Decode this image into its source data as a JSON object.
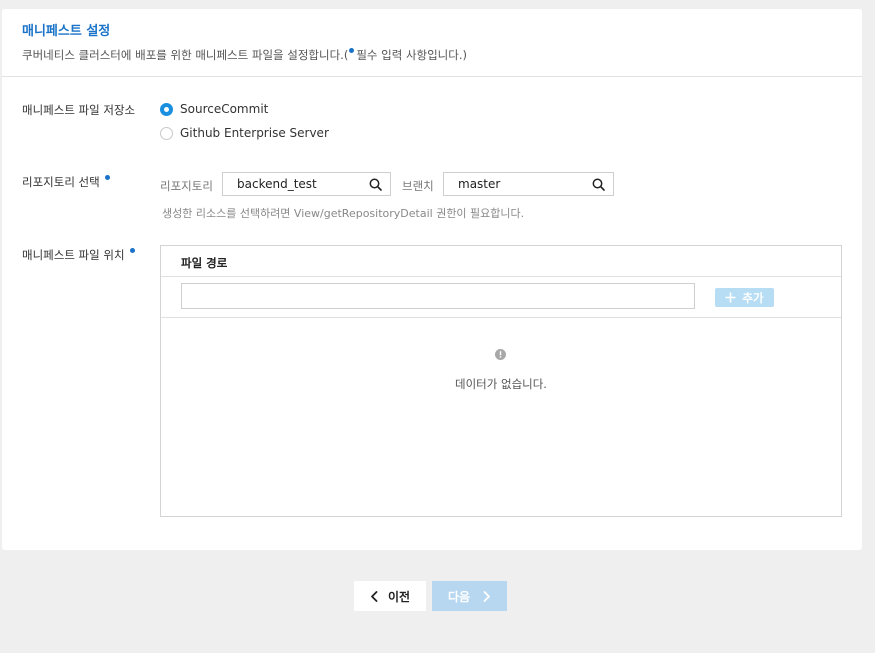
{
  "header": {
    "title": "매니페스트 설정",
    "description": "쿠버네티스 클러스터에 배포를 위한 매니페스트 파일을 설정합니다.(",
    "required_note": "필수 입력 사항입니다.)"
  },
  "repository_source": {
    "label": "매니페스트 파일 저장소",
    "options": [
      {
        "label": "SourceCommit",
        "selected": true
      },
      {
        "label": "Github Enterprise Server",
        "selected": false
      }
    ]
  },
  "repository_select": {
    "label": "리포지토리 선택",
    "repository_label": "리포지토리",
    "repository_value": "backend_test",
    "branch_label": "브랜치",
    "branch_value": "master",
    "hint": "생성한 리소스를 선택하려면 View/getRepositoryDetail 권한이 필요합니다."
  },
  "manifest_location": {
    "label": "매니페스트 파일 위치",
    "column_header": "파일 경로",
    "path_input_value": "",
    "add_label": "추가",
    "empty_text": "데이터가 없습니다."
  },
  "footer": {
    "prev_label": "이전",
    "next_label": "다음"
  },
  "colors": {
    "accent": "#1a8fe0",
    "title_blue": "#1a73c8",
    "disabled_button": "#b7d7f1"
  }
}
